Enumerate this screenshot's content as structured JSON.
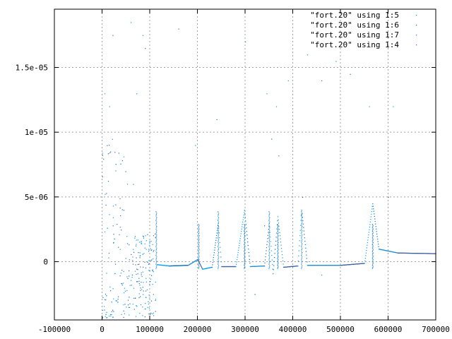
{
  "chart_data": {
    "type": "scatter",
    "title": "",
    "xlabel": "",
    "ylabel": "",
    "xlim": [
      -100000,
      700000
    ],
    "ylim": [
      -4.5e-06,
      1.95e-05
    ],
    "grid": true,
    "legend_position": "top-right",
    "x_ticks": [
      -100000,
      0,
      100000,
      200000,
      300000,
      400000,
      500000,
      600000,
      700000
    ],
    "x_tick_labels": [
      "-100000",
      "0",
      "100000",
      "200000",
      "300000",
      "400000",
      "500000",
      "600000",
      "700000"
    ],
    "y_ticks": [
      0,
      5e-06,
      1e-05,
      1.5e-05
    ],
    "y_tick_labels": [
      "0",
      "5e-06",
      "1e-05",
      "1.5e-05"
    ],
    "series": [
      {
        "name": "\"fort.20\" using 1:5",
        "color": "#00a0ff",
        "marker": "dot"
      },
      {
        "name": "\"fort.20\" using 1:6",
        "color": "#0070c0",
        "marker": "dot"
      },
      {
        "name": "\"fort.20\" using 1:7",
        "color": "#2090d0",
        "marker": "dot"
      },
      {
        "name": "\"fort.20\" using 1:4",
        "color": "#4060a0",
        "marker": "dot"
      }
    ],
    "resonance_centers": [
      113000,
      202000,
      243000,
      298000,
      350000,
      368000,
      418000,
      567000
    ],
    "baseline_points": [
      [
        115000,
        -2e-07
      ],
      [
        140000,
        -3e-07
      ],
      [
        180000,
        -2.5e-07
      ],
      [
        200000,
        2e-07
      ],
      [
        210000,
        -5.5e-07
      ],
      [
        230000,
        -4e-07
      ],
      [
        243000,
        3e-06
      ],
      [
        250000,
        -3.5e-07
      ],
      [
        280000,
        -3.5e-07
      ],
      [
        298000,
        4e-06
      ],
      [
        310000,
        -3.5e-07
      ],
      [
        340000,
        -3e-07
      ],
      [
        350000,
        3e-06
      ],
      [
        358000,
        -9e-07
      ],
      [
        368000,
        3.5e-06
      ],
      [
        380000,
        -4e-07
      ],
      [
        410000,
        -3e-07
      ],
      [
        418000,
        4e-06
      ],
      [
        430000,
        -2.5e-07
      ],
      [
        500000,
        -2.5e-07
      ],
      [
        550000,
        -1e-07
      ],
      [
        567000,
        4.5e-06
      ],
      [
        580000,
        1e-06
      ],
      [
        620000,
        7e-07
      ],
      [
        700000,
        6.5e-07
      ]
    ],
    "scattered_points": [
      [
        5000,
        1.3e-05
      ],
      [
        10000,
        9e-06
      ],
      [
        15000,
        1.2e-05
      ],
      [
        22000,
        1.75e-05
      ],
      [
        30000,
        -3e-06
      ],
      [
        45000,
        4e-06
      ],
      [
        60000,
        1.85e-05
      ],
      [
        65000,
        6e-06
      ],
      [
        72000,
        1.3e-05
      ],
      [
        80000,
        -2e-06
      ],
      [
        85000,
        1.75e-05
      ],
      [
        90000,
        1.65e-05
      ],
      [
        95000,
        -3.5e-06
      ],
      [
        100000,
        -1.5e-06
      ],
      [
        105000,
        -4e-06
      ],
      [
        160000,
        1.8e-05
      ],
      [
        195000,
        9e-06
      ],
      [
        240000,
        1.1e-05
      ],
      [
        300000,
        1.7e-05
      ],
      [
        340000,
        2.8e-06
      ],
      [
        345000,
        1.3e-05
      ],
      [
        355000,
        9.5e-06
      ],
      [
        365000,
        1.2e-05
      ],
      [
        370000,
        8.2e-06
      ],
      [
        390000,
        1.4e-05
      ],
      [
        420000,
        5e-06
      ],
      [
        430000,
        1.6e-05
      ],
      [
        460000,
        1.4e-05
      ],
      [
        490000,
        1.55e-05
      ],
      [
        520000,
        1.45e-05
      ],
      [
        560000,
        1.2e-05
      ],
      [
        600000,
        5e-06
      ],
      [
        610000,
        1.2e-05
      ],
      [
        320000,
        -2.5e-06
      ],
      [
        460000,
        -1e-06
      ]
    ]
  }
}
